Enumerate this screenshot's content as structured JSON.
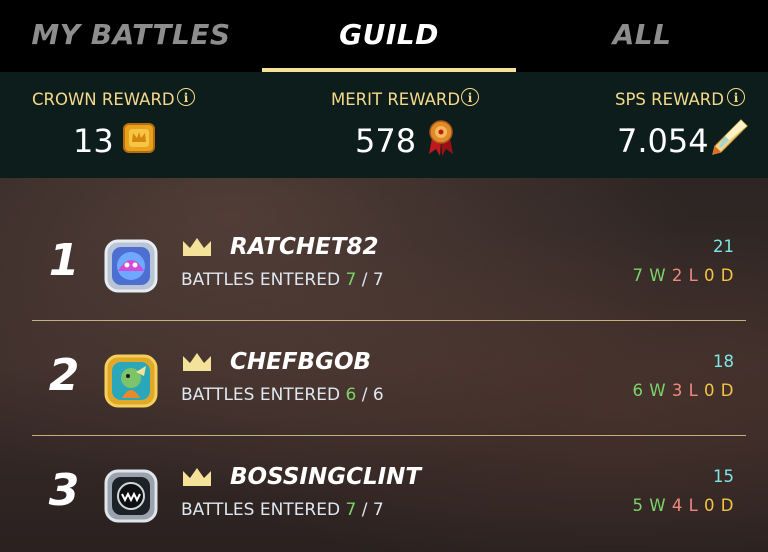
{
  "tabs": [
    {
      "label": "MY BATTLES",
      "active": false
    },
    {
      "label": "GUILD",
      "active": true
    },
    {
      "label": "ALL",
      "active": false
    }
  ],
  "rewards": [
    {
      "label": "CROWN REWARD",
      "value": "13",
      "icon": "crown-token-icon"
    },
    {
      "label": "MERIT REWARD",
      "value": "578",
      "icon": "merit-medal-icon"
    },
    {
      "label": "SPS REWARD",
      "value": "7.054",
      "icon": "sps-crystal-icon"
    }
  ],
  "info_glyph": "i",
  "battles_label": "BATTLES ENTERED",
  "battles_sep": "/",
  "players": [
    {
      "rank": "1",
      "name": "RATCHET82",
      "entered": "7",
      "total": "7",
      "score": "21",
      "w": "7",
      "l": "2",
      "d": "0"
    },
    {
      "rank": "2",
      "name": "CHEFBGOB",
      "entered": "6",
      "total": "6",
      "score": "18",
      "w": "6",
      "l": "3",
      "d": "0"
    },
    {
      "rank": "3",
      "name": "BOSSINGCLINT",
      "entered": "7",
      "total": "7",
      "score": "15",
      "w": "5",
      "l": "4",
      "d": "0"
    }
  ],
  "record_labels": {
    "w": "W",
    "l": "L",
    "d": "D"
  },
  "colors": {
    "accent": "#f4e29b",
    "reward_label": "#f5d98a",
    "score": "#7fe6e6",
    "win": "#7bd36a",
    "loss": "#f08a80",
    "draw": "#f5c542"
  }
}
